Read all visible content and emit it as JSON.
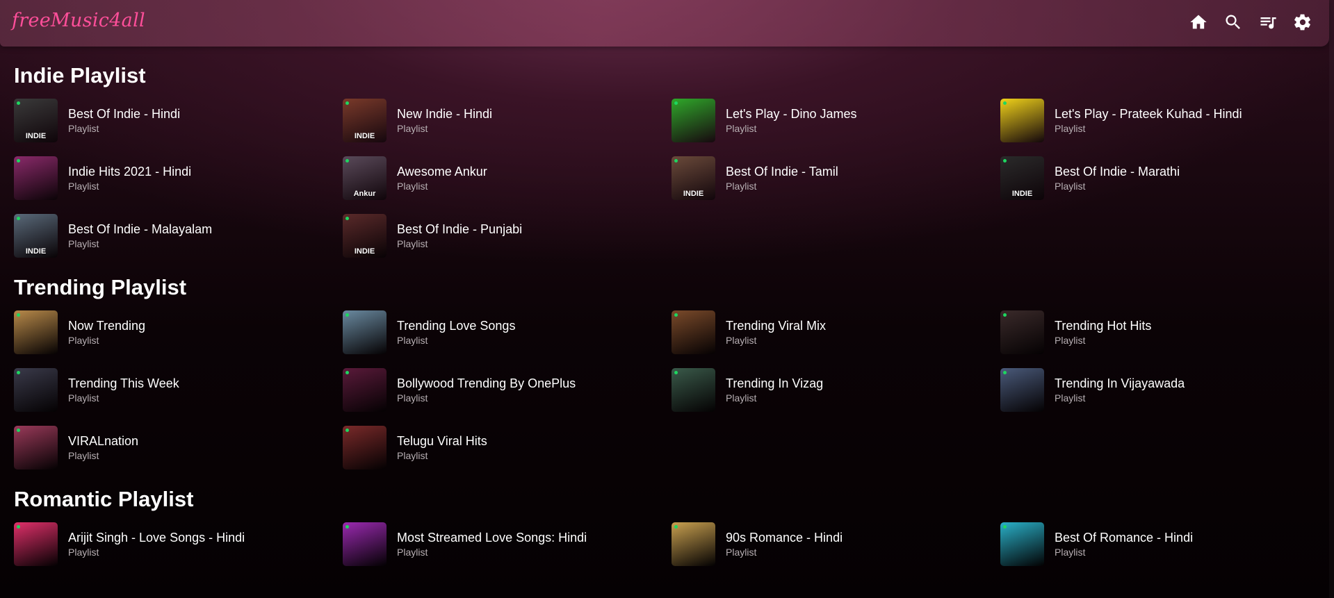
{
  "header": {
    "logo": "freeMusic4all",
    "nav": [
      {
        "name": "home-icon"
      },
      {
        "name": "search-icon"
      },
      {
        "name": "queue-icon"
      },
      {
        "name": "settings-icon"
      }
    ]
  },
  "sections": [
    {
      "title": "Indie Playlist",
      "items": [
        {
          "title": "Best Of Indie - Hindi",
          "subtitle": "Playlist",
          "thumb_text": "INDIE",
          "color": "#3a3a3a"
        },
        {
          "title": "New Indie - Hindi",
          "subtitle": "Playlist",
          "thumb_text": "INDIE",
          "color": "#7a3a2a"
        },
        {
          "title": "Let's Play - Dino James",
          "subtitle": "Playlist",
          "thumb_text": "",
          "color": "#2fa82a"
        },
        {
          "title": "Let's Play - Prateek Kuhad - Hindi",
          "subtitle": "Playlist",
          "thumb_text": "",
          "color": "#f0d21a"
        },
        {
          "title": "Indie Hits 2021 - Hindi",
          "subtitle": "Playlist",
          "thumb_text": "",
          "color": "#8a2a6a"
        },
        {
          "title": "Awesome Ankur",
          "subtitle": "Playlist",
          "thumb_text": "Ankur",
          "color": "#5a4a5a"
        },
        {
          "title": "Best Of Indie - Tamil",
          "subtitle": "Playlist",
          "thumb_text": "INDIE",
          "color": "#6a4a3a"
        },
        {
          "title": "Best Of Indie - Marathi",
          "subtitle": "Playlist",
          "thumb_text": "INDIE",
          "color": "#2a2a2a"
        },
        {
          "title": "Best Of Indie - Malayalam",
          "subtitle": "Playlist",
          "thumb_text": "INDIE",
          "color": "#5a6a7a"
        },
        {
          "title": "Best Of Indie - Punjabi",
          "subtitle": "Playlist",
          "thumb_text": "INDIE",
          "color": "#5a2a2a"
        }
      ]
    },
    {
      "title": "Trending Playlist",
      "items": [
        {
          "title": "Now Trending",
          "subtitle": "Playlist",
          "thumb_text": "",
          "color": "#b88a4a"
        },
        {
          "title": "Trending Love Songs",
          "subtitle": "Playlist",
          "thumb_text": "",
          "color": "#6a8aa0"
        },
        {
          "title": "Trending Viral Mix",
          "subtitle": "Playlist",
          "thumb_text": "",
          "color": "#7a4a2a"
        },
        {
          "title": "Trending Hot Hits",
          "subtitle": "Playlist",
          "thumb_text": "",
          "color": "#3a2a2a"
        },
        {
          "title": "Trending This Week",
          "subtitle": "Playlist",
          "thumb_text": "",
          "color": "#3a3a4a"
        },
        {
          "title": "Bollywood Trending By OnePlus",
          "subtitle": "Playlist",
          "thumb_text": "",
          "color": "#5a1a3a"
        },
        {
          "title": "Trending In Vizag",
          "subtitle": "Playlist",
          "thumb_text": "",
          "color": "#3a5a4a"
        },
        {
          "title": "Trending In Vijayawada",
          "subtitle": "Playlist",
          "thumb_text": "",
          "color": "#4a5a7a"
        },
        {
          "title": "VIRALnation",
          "subtitle": "Playlist",
          "thumb_text": "",
          "color": "#9a3a5a"
        },
        {
          "title": "Telugu Viral Hits",
          "subtitle": "Playlist",
          "thumb_text": "",
          "color": "#7a2a2a"
        }
      ]
    },
    {
      "title": "Romantic Playlist",
      "items": [
        {
          "title": "Arijit Singh - Love Songs - Hindi",
          "subtitle": "Playlist",
          "thumb_text": "",
          "color": "#e0306a"
        },
        {
          "title": "Most Streamed Love Songs: Hindi",
          "subtitle": "Playlist",
          "thumb_text": "",
          "color": "#9a2ab0"
        },
        {
          "title": "90s Romance - Hindi",
          "subtitle": "Playlist",
          "thumb_text": "",
          "color": "#c8a050"
        },
        {
          "title": "Best Of Romance - Hindi",
          "subtitle": "Playlist",
          "thumb_text": "",
          "color": "#2ab0c8"
        }
      ]
    }
  ]
}
